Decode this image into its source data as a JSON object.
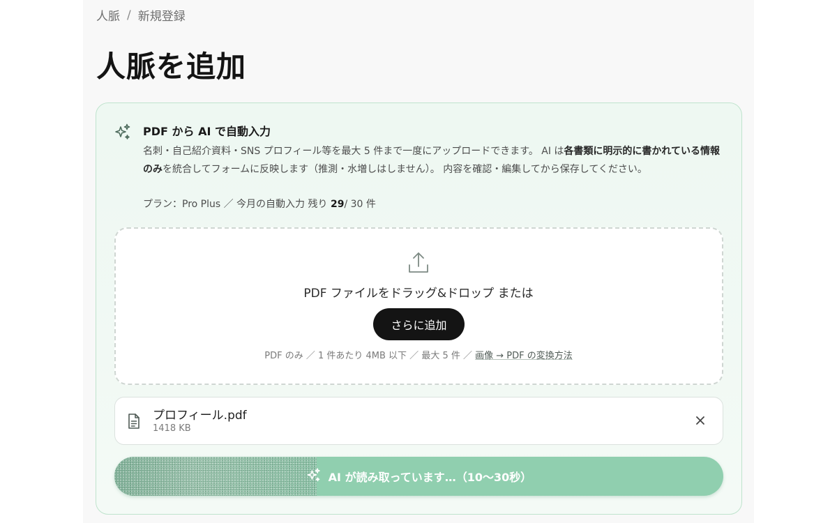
{
  "breadcrumb": {
    "items": [
      "人脈",
      "新規登録"
    ],
    "separator": "/"
  },
  "page": {
    "title": "人脈を追加"
  },
  "ai_card": {
    "title": "PDF から AI で自動入力",
    "desc_part1": "名刺・自己紹介資料・SNS プロフィール等を最大 5 件まで一度にアップロードできます。 AI は",
    "desc_bold": "各書類に明示的に書かれている情報のみ",
    "desc_part2": "を統合してフォームに反映します（推測・水増しはしません）。 内容を確認・編集してから保存してください。",
    "plan_prefix": "プラン：Pro Plus ／ 今月の自動入力 残り ",
    "plan_remaining": "29",
    "plan_suffix": "/ 30 件",
    "icon": "sparkle-icon"
  },
  "dropzone": {
    "instruction": "PDF ファイルをドラッグ&ドロップ または",
    "add_button_label": "さらに追加",
    "hint_prefix": "PDF のみ ／ 1 件あたり 4MB 以下 ／ 最大 5 件 ／ ",
    "hint_link": "画像 → PDF の変換方法",
    "icon": "upload-icon"
  },
  "files": [
    {
      "name": "プロフィール.pdf",
      "size": "1418 KB",
      "icon": "file-text-icon"
    }
  ],
  "submit": {
    "label": "AI が読み取っています…（10〜30秒）",
    "icon": "sparkle-icon",
    "color": "#90cfaf"
  },
  "colors": {
    "accent_green": "#bfe3cd",
    "button_dark": "#141414"
  }
}
